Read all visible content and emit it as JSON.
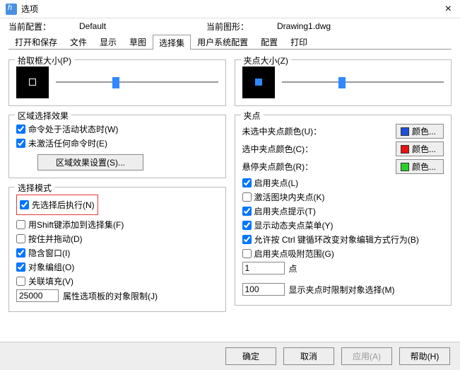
{
  "window": {
    "title": "选项"
  },
  "info": {
    "profile_label": "当前配置：",
    "profile_value": "Default",
    "drawing_label": "当前图形：",
    "drawing_value": "Drawing1.dwg"
  },
  "tabs": {
    "0": "打开和保存",
    "1": "文件",
    "2": "显示",
    "3": "草图",
    "4": "选择集",
    "5": "用户系统配置",
    "6": "配置",
    "7": "打印"
  },
  "left": {
    "pickbox_title": "拾取框大小(P)",
    "area_title": "区域选择效果",
    "chk_active": "命令处于活动状态时(W)",
    "chk_nocmd": "未激活任何命令时(E)",
    "btn_areaset": "区域效果设置(S)...",
    "mode_title": "选择模式",
    "chk_noun": "先选择后执行(N)",
    "chk_shift": "用Shift键添加到选择集(F)",
    "chk_drag": "按住并拖动(D)",
    "chk_implied": "隐含窗口(I)",
    "chk_group": "对象编组(O)",
    "chk_hatch": "关联填充(V)",
    "limit_value": "25000",
    "limit_label": "属性选项板的对象限制(J)"
  },
  "right": {
    "grip_title": "夹点大小(Z)",
    "grips_title": "夹点",
    "unsel_label": "未选中夹点颜色(U)：",
    "sel_label": "选中夹点颜色(C)：",
    "hover_label": "悬停夹点颜色(R)：",
    "color_text": "颜色...",
    "chk_enable": "启用夹点(L)",
    "chk_block": "激活图块内夹点(K)",
    "chk_tips": "启用夹点提示(T)",
    "chk_dynmenu": "显示动态夹点菜单(Y)",
    "chk_ctrl": "允许按 Ctrl 键循环改变对象编辑方式行为(B)",
    "chk_snap": "启用夹点吸附范围(G)",
    "snap_value": "1",
    "snap_label": "点",
    "limit_value": "100",
    "limit_label": "显示夹点时限制对象选择(M)"
  },
  "footer": {
    "ok": "确定",
    "cancel": "取消",
    "apply": "应用(A)",
    "help": "帮助(H)"
  },
  "colors": {
    "unselected": "#2050d8",
    "selected": "#e81010",
    "hover": "#28d028"
  }
}
